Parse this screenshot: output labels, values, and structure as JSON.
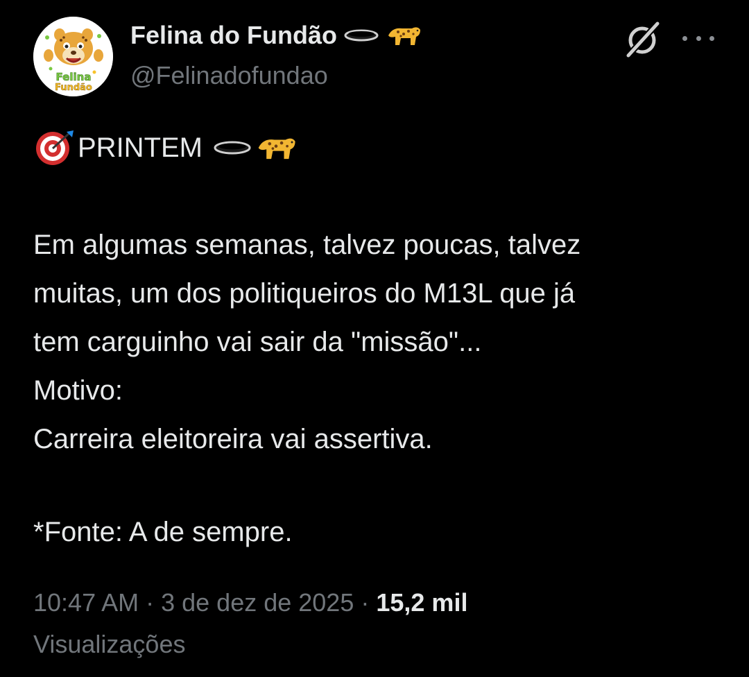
{
  "author": {
    "display_name": "Felina do Fundão",
    "handle": "@Felinadofundao",
    "avatar_text_line1": "Felina",
    "avatar_text_line2": "Fundão"
  },
  "icons": {
    "name_suffix": [
      "hole-icon",
      "leopard-icon"
    ],
    "header_actions": [
      "grok-icon",
      "more-options-icon"
    ],
    "body_prefix": "direct-hit-target-icon",
    "body_suffix": [
      "hole-icon",
      "leopard-icon"
    ]
  },
  "tweet": {
    "headline": "PRINTEM",
    "paragraph_lines": [
      "Em algumas semanas, talvez poucas, talvez",
      "muitas, um dos politiqueiros do M13L que já",
      "tem carguinho vai sair da \"missão\"...",
      "Motivo:",
      "Carreira eleitoreira vai assertiva."
    ],
    "source_line": "*Fonte: A de sempre."
  },
  "meta": {
    "time": "10:47 AM",
    "separator": "·",
    "date": "3 de dez de 2025",
    "views_count": "15,2 mil",
    "views_label": "Visualizações"
  },
  "colors": {
    "background": "#000000",
    "primary_text": "#e7e9ea",
    "secondary_text": "#71767b"
  }
}
